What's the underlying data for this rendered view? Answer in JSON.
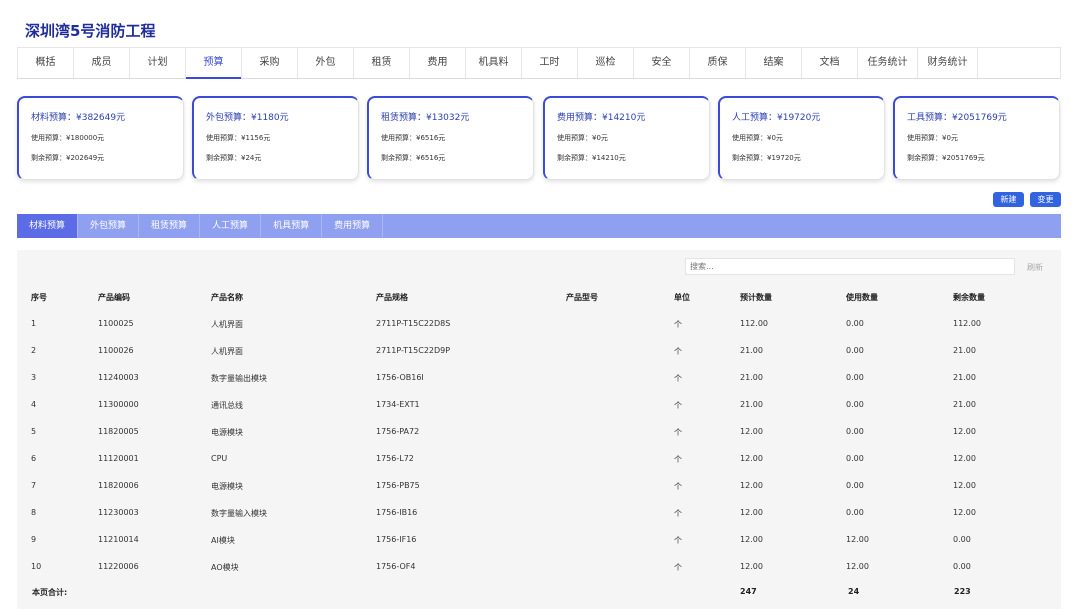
{
  "project_title": "深圳湾5号消防工程",
  "tabs": [
    "概括",
    "成员",
    "计划",
    "预算",
    "采购",
    "外包",
    "租赁",
    "费用",
    "机具料",
    "工时",
    "巡检",
    "安全",
    "质保",
    "结案",
    "文档",
    "任务统计",
    "财务统计"
  ],
  "active_tab": "预算",
  "cards": [
    {
      "title": "材料预算：¥382649元",
      "used": "使用预算：¥180000元",
      "remaining": "剩余预算：¥202649元"
    },
    {
      "title": "外包预算：¥1180元",
      "used": "使用预算：¥1156元",
      "remaining": "剩余预算：¥24元"
    },
    {
      "title": "租赁预算：¥13032元",
      "used": "使用预算：¥6516元",
      "remaining": "剩余预算：¥6516元"
    },
    {
      "title": "费用预算：¥14210元",
      "used": "使用预算：¥0元",
      "remaining": "剩余预算：¥14210元"
    },
    {
      "title": "人工预算：¥19720元",
      "used": "使用预算：¥0元",
      "remaining": "剩余预算：¥19720元"
    },
    {
      "title": "工具预算：¥2051769元",
      "used": "使用预算：¥0元",
      "remaining": "剩余预算：¥2051769元"
    }
  ],
  "buttons": {
    "new": "新建",
    "change": "变更"
  },
  "subtabs": [
    "材料预算",
    "外包预算",
    "租赁预算",
    "人工预算",
    "机具预算",
    "费用预算"
  ],
  "active_subtab": "材料预算",
  "search": {
    "placeholder": "搜索..."
  },
  "refresh_label": "刷新",
  "table": {
    "headers": [
      "序号",
      "产品编码",
      "产品名称",
      "产品规格",
      "产品型号",
      "单位",
      "预计数量",
      "使用数量",
      "剩余数量"
    ],
    "rows": [
      [
        "1",
        "1100025",
        "人机界面",
        "2711P-T15C22D8S",
        "",
        "个",
        "112.00",
        "0.00",
        "112.00"
      ],
      [
        "2",
        "1100026",
        "人机界面",
        "2711P-T15C22D9P",
        "",
        "个",
        "21.00",
        "0.00",
        "21.00"
      ],
      [
        "3",
        "11240003",
        "数字量输出模块",
        "1756-OB16I",
        "",
        "个",
        "21.00",
        "0.00",
        "21.00"
      ],
      [
        "4",
        "11300000",
        "通讯总线",
        "1734-EXT1",
        "",
        "个",
        "21.00",
        "0.00",
        "21.00"
      ],
      [
        "5",
        "11820005",
        "电源模块",
        "1756-PA72",
        "",
        "个",
        "12.00",
        "0.00",
        "12.00"
      ],
      [
        "6",
        "11120001",
        "CPU",
        "1756-L72",
        "",
        "个",
        "12.00",
        "0.00",
        "12.00"
      ],
      [
        "7",
        "11820006",
        "电源模块",
        "1756-PB75",
        "",
        "个",
        "12.00",
        "0.00",
        "12.00"
      ],
      [
        "8",
        "11230003",
        "数字量输入模块",
        "1756-IB16",
        "",
        "个",
        "12.00",
        "0.00",
        "12.00"
      ],
      [
        "9",
        "11210014",
        "AI模块",
        "1756-IF16",
        "",
        "个",
        "12.00",
        "12.00",
        "0.00"
      ],
      [
        "10",
        "11220006",
        "AO模块",
        "1756-OF4",
        "",
        "个",
        "12.00",
        "12.00",
        "0.00"
      ]
    ],
    "footer": {
      "label": "本页合计:",
      "expected": "247",
      "used": "24",
      "remaining": "223"
    }
  }
}
